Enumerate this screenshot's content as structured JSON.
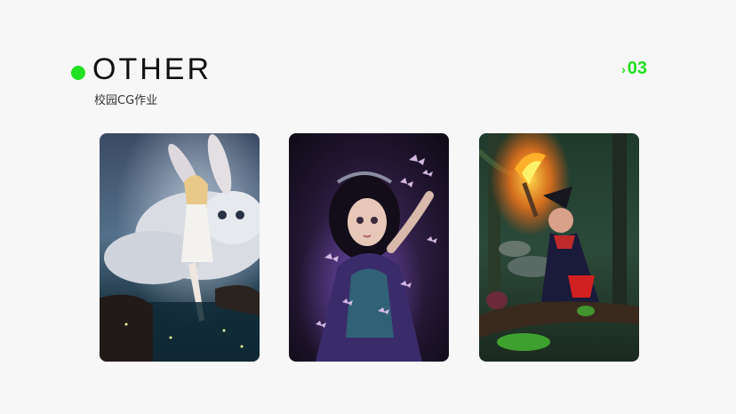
{
  "header": {
    "title": "OTHER",
    "subtitle": "校园CG作业",
    "page_number": "03",
    "page_marker_glyph": "›"
  },
  "colors": {
    "accent": "#22e022",
    "background": "#f7f7f7",
    "title": "#111111"
  },
  "gallery": {
    "items": [
      {
        "subject": "fantasy girl with white giant rabbit"
      },
      {
        "subject": "fairy girl with glowing butterflies"
      },
      {
        "subject": "witch holding a torch in dark forest"
      }
    ]
  }
}
